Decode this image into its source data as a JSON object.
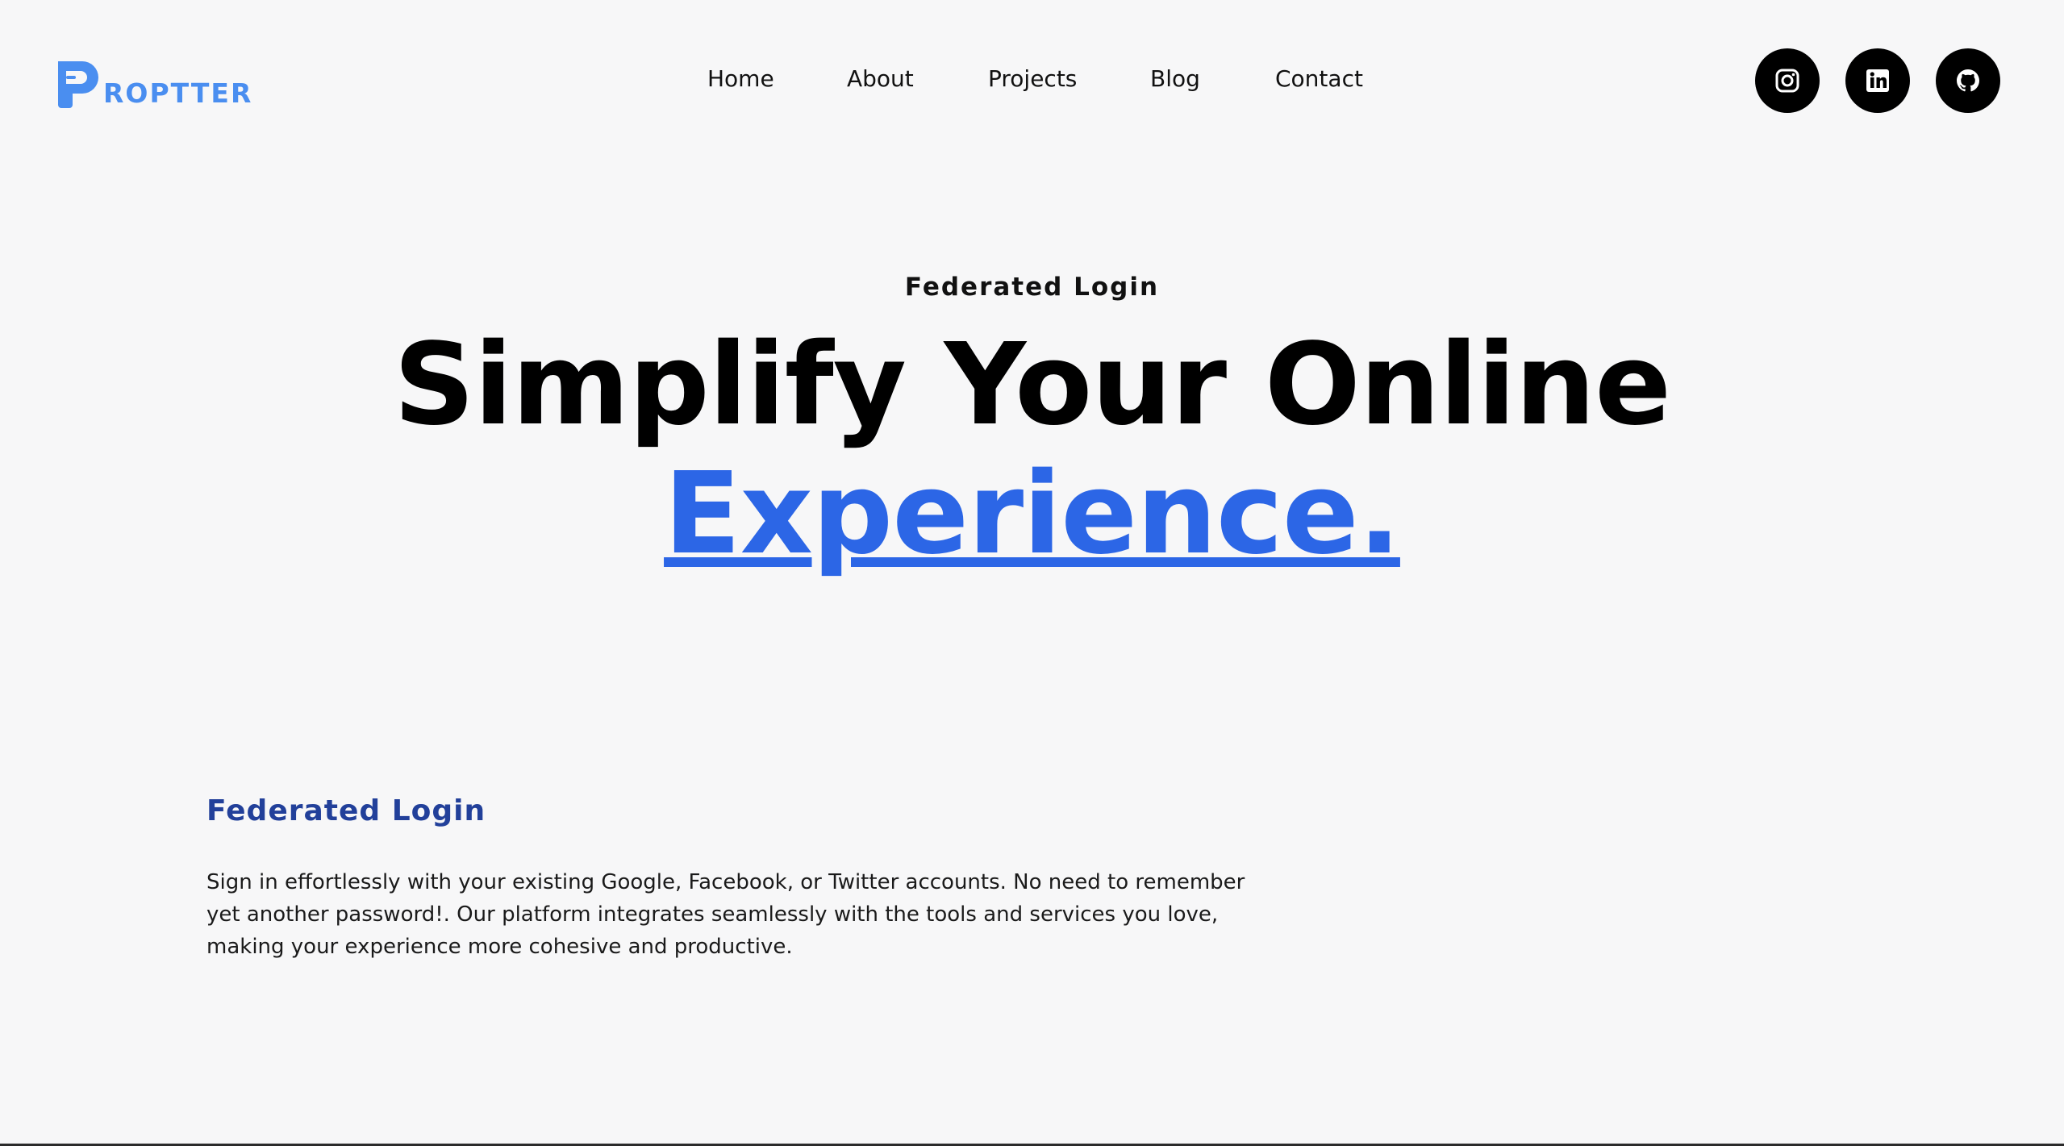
{
  "brand": {
    "name": "ROPTTER",
    "accent_color": "#4a8ef0",
    "logo_icon": "p-letter-logo-icon"
  },
  "nav": {
    "items": [
      {
        "label": "Home"
      },
      {
        "label": "About"
      },
      {
        "label": "Projects"
      },
      {
        "label": "Blog"
      },
      {
        "label": "Contact"
      }
    ]
  },
  "social": [
    {
      "icon": "instagram-icon",
      "color": "#000000"
    },
    {
      "icon": "linkedin-icon",
      "color": "#000000"
    },
    {
      "icon": "github-icon",
      "color": "#000000"
    }
  ],
  "hero": {
    "eyebrow": "Federated Login",
    "title_line1": "Simplify Your Online",
    "title_line2": "Experience.",
    "highlight_color": "#2c66e6"
  },
  "feature": {
    "heading": "Federated Login",
    "heading_color": "#22409a",
    "body": "Sign in effortlessly with your existing Google, Facebook, or Twitter accounts. No need to remember yet another password!. Our platform integrates seamlessly with the tools and services you love, making your experience more cohesive and productive."
  }
}
